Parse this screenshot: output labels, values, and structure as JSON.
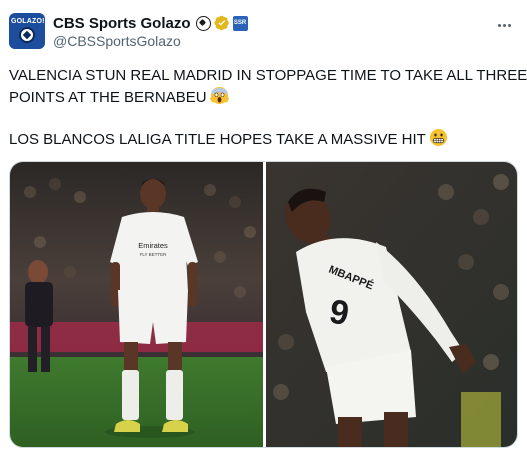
{
  "author": {
    "display_name": "CBS Sports Golazo",
    "handle": "@CBSSportsGolazo",
    "avatar_text": "GOLAZO!",
    "affiliate_badge_text": "SSR"
  },
  "tweet": {
    "line1": "VALENCIA STUN REAL MADRID IN STOPPAGE TIME TO TAKE ALL THREE",
    "line2": "POINTS AT THE BERNABEU",
    "line3": "LOS BLANCOS LALIGA TITLE HOPES TAKE A MASSIVE HIT"
  },
  "media": {
    "photo_left": {
      "shirt_sponsor": "Emirates",
      "shirt_sponsor_sub": "FLY BETTER"
    },
    "photo_right": {
      "shirt_name": "MBAPPÉ",
      "shirt_number": "9"
    }
  },
  "icons": {
    "header": [
      "soccer-ball-icon",
      "verified-badge-icon",
      "affiliate-badge-icon",
      "more-options-icon"
    ],
    "text": [
      "screaming-face-emoji",
      "grimacing-face-emoji"
    ]
  },
  "colors": {
    "text": "#0f1419",
    "secondary": "#536471",
    "verified": "#e2b719",
    "border": "#cfd9de"
  }
}
